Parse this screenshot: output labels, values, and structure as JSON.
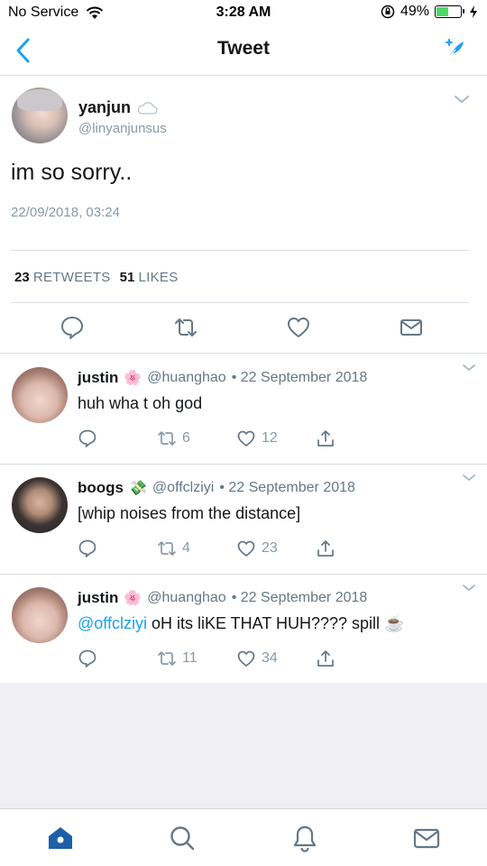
{
  "status_bar": {
    "carrier": "No Service",
    "time": "3:28 AM",
    "battery_percent": "49%",
    "battery_level": 0.49
  },
  "nav": {
    "title": "Tweet"
  },
  "main_tweet": {
    "author_name": "yanjun",
    "author_handle": "@linyanjunsus",
    "text": "im so sorry..",
    "timestamp": "22/09/2018, 03:24",
    "retweets_count": "23",
    "retweets_label": "RETWEETS",
    "likes_count": "51",
    "likes_label": "LIKES"
  },
  "replies": [
    {
      "name": "justin",
      "emoji": "🌸",
      "handle": "@huanghao",
      "date": "• 22 September 2018",
      "mention": "",
      "text": "huh wha t oh god",
      "retweets": "6",
      "likes": "12"
    },
    {
      "name": "boogs",
      "emoji": "💸",
      "handle": "@offclziyi",
      "date": "• 22 September 2018",
      "mention": "",
      "text": "[whip noises from the distance]",
      "retweets": "4",
      "likes": "23"
    },
    {
      "name": "justin",
      "emoji": "🌸",
      "handle": "@huanghao",
      "date": "• 22 September 2018",
      "mention": "@offclziyi",
      "text": " oH its liKE THAT HUH???? spill ☕",
      "retweets": "11",
      "likes": "34"
    }
  ],
  "colors": {
    "accent": "#1da1f2",
    "muted": "#8899a6",
    "battery": "#4cd964"
  },
  "tabs": [
    "home-icon",
    "search-icon",
    "notifications-icon",
    "messages-icon"
  ]
}
